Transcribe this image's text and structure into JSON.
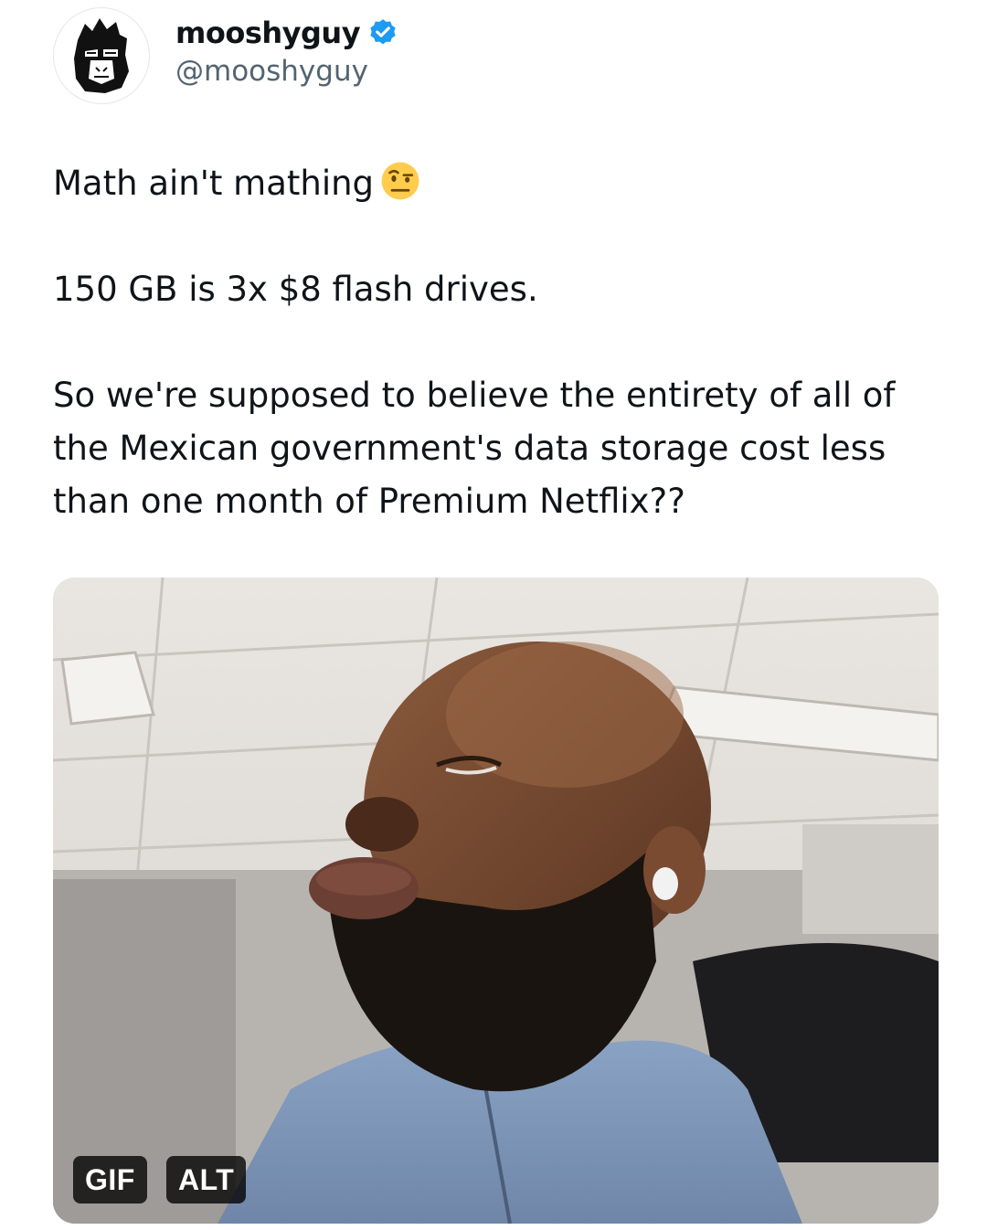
{
  "tweet": {
    "display_name": "mooshyguy",
    "handle": "@mooshyguy",
    "verified_icon": "verified-badge-icon",
    "avatar_icon": "gorilla-avatar-icon",
    "accent_color": "#1d9bf0",
    "text": {
      "line1": "Math ain't mathing",
      "line1_emoji": "face-with-raised-eyebrow-emoji",
      "line2": "150 GB is 3x $8 flash drives.",
      "line3": "So we're supposed to believe the entirety of all of the Mexican government's data storage cost less than one month of Premium Netflix??"
    },
    "media": {
      "badge_gif": "GIF",
      "badge_alt": "ALT"
    }
  }
}
